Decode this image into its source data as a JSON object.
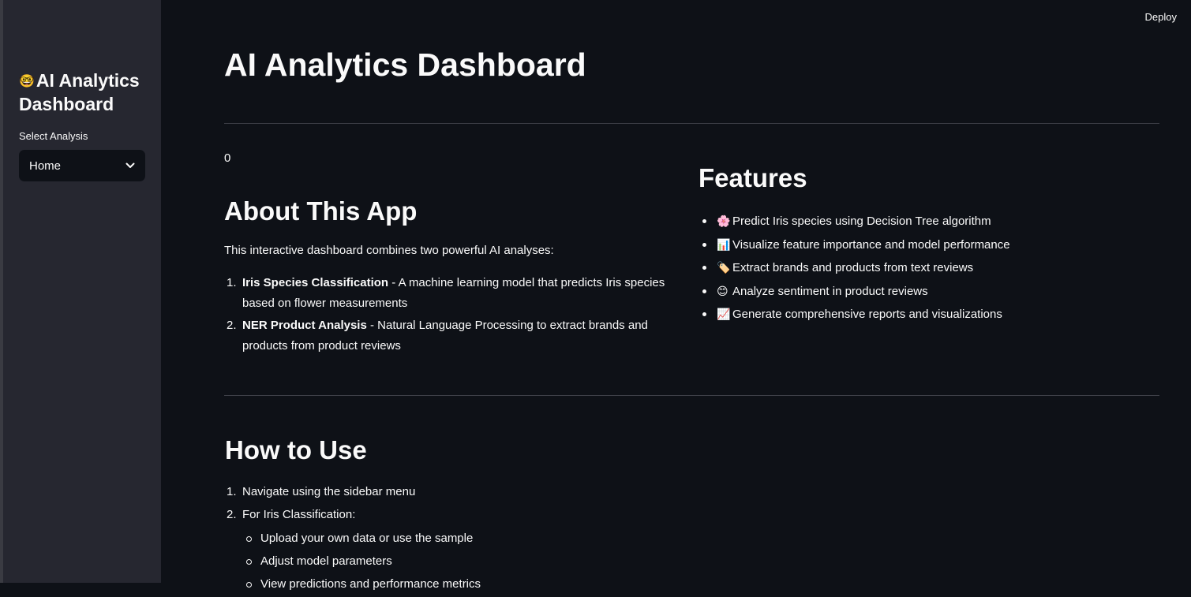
{
  "header": {
    "deploy_label": "Deploy"
  },
  "sidebar": {
    "logo_glyph": "🤓",
    "title": "AI Analytics Dashboard",
    "select_label": "Select Analysis",
    "select_value": "Home"
  },
  "main": {
    "title": "AI Analytics Dashboard",
    "counter_text": "0",
    "about": {
      "heading": "About This App",
      "intro": "This interactive dashboard combines two powerful AI analyses:",
      "items": [
        {
          "num": "1.",
          "bold": "Iris Species Classification",
          "rest": " - A machine learning model that predicts Iris species based on flower measurements"
        },
        {
          "num": "2.",
          "bold": "NER Product Analysis",
          "rest": " - Natural Language Processing to extract brands and products from product reviews"
        }
      ]
    },
    "features": {
      "heading": "Features",
      "items": [
        {
          "emoji": "🌸",
          "text": "Predict Iris species using Decision Tree algorithm"
        },
        {
          "emoji": "📊",
          "text": "Visualize feature importance and model performance"
        },
        {
          "emoji": "🏷️",
          "text": "Extract brands and products from text reviews"
        },
        {
          "emoji": "😊",
          "text": "Analyze sentiment in product reviews"
        },
        {
          "emoji": "📈",
          "text": "Generate comprehensive reports and visualizations"
        }
      ]
    },
    "how_to": {
      "heading": "How to Use",
      "items": [
        {
          "num": "1.",
          "text": "Navigate using the sidebar menu"
        },
        {
          "num": "2.",
          "text": "For Iris Classification:"
        }
      ],
      "sub_items": [
        "Upload your own data or use the sample",
        "Adjust model parameters",
        "View predictions and performance metrics"
      ]
    }
  }
}
